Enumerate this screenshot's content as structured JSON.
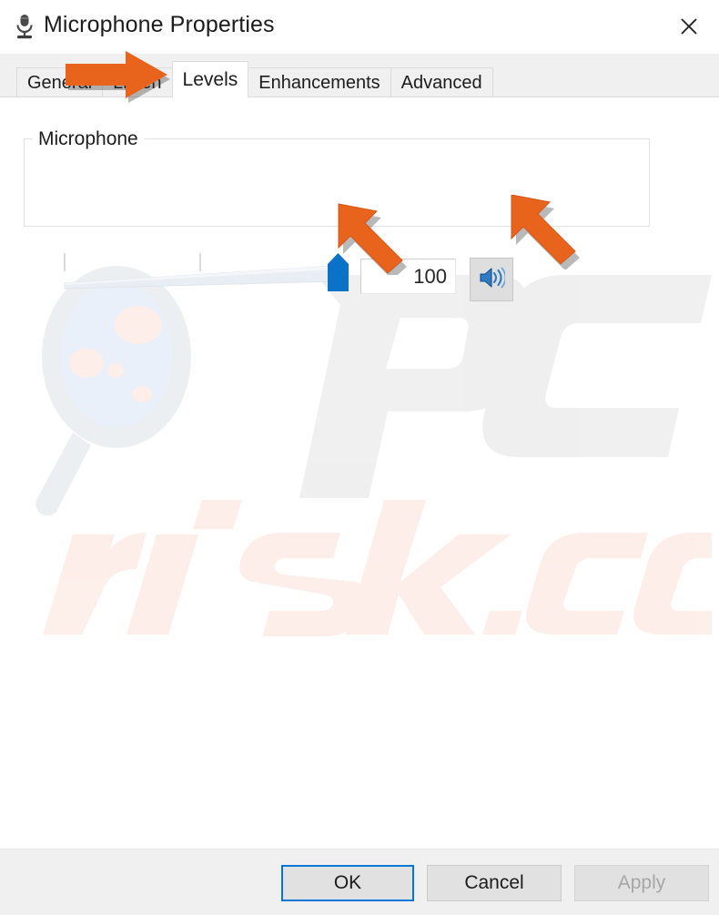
{
  "window": {
    "title": "Microphone Properties",
    "title_icon": "microphone-icon",
    "close_label": "✕"
  },
  "tabs": [
    {
      "label": "General",
      "active": false
    },
    {
      "label": "Listen",
      "active": false
    },
    {
      "label": "Levels",
      "active": true
    },
    {
      "label": "Enhancements",
      "active": false
    },
    {
      "label": "Advanced",
      "active": false
    }
  ],
  "levels_panel": {
    "group_label": "Microphone",
    "slider": {
      "value": 100,
      "min": 0,
      "max": 100,
      "tick_count": 2
    },
    "value_field": "100",
    "mute_button": {
      "icon": "speaker-unmuted-icon",
      "state": "unmuted"
    }
  },
  "footer": {
    "ok_label": "OK",
    "cancel_label": "Cancel",
    "apply_label": "Apply",
    "apply_enabled": false
  },
  "watermark": {
    "primary_text": "PC",
    "secondary_text": "risk.com",
    "icon": "magnifier-icon"
  },
  "annotations": [
    {
      "name": "arrow-to-levels-tab",
      "direction": "right",
      "color": "#e8641c"
    },
    {
      "name": "arrow-to-slider",
      "direction": "up-left",
      "color": "#e8641c"
    },
    {
      "name": "arrow-to-mute-button",
      "direction": "up-left",
      "color": "#e8641c"
    }
  ],
  "colors": {
    "accent": "#0078d7",
    "slider_thumb": "#0a73c8",
    "annotation": "#e8641c",
    "window_bg": "#f0f0f0",
    "panel_bg": "#ffffff"
  }
}
